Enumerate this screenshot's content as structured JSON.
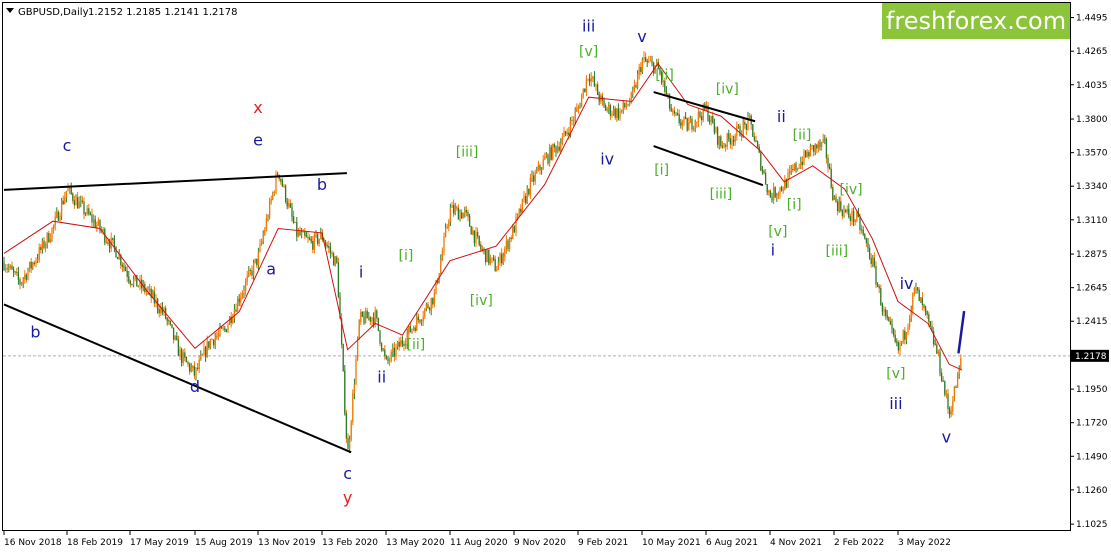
{
  "header": {
    "symbol_label": "GBPUSD,Daily",
    "ohlc": "1.2152 1.2185 1.2141 1.2178",
    "menu_icon": "triangle-down-icon"
  },
  "logo": {
    "text": "freshforex.com",
    "color": "#8cc43a"
  },
  "current_price": {
    "value": "1.2178",
    "badge_color": "#000000"
  },
  "colors": {
    "candle": "#f07800",
    "candle_alt": "#2a7a2a",
    "moving_average": "#d01010",
    "wave_blue": "#1a1aa0",
    "wave_green": "#4ab02a",
    "wave_red": "#e02020"
  },
  "chart_data": {
    "type": "line",
    "instrument": "GBPUSD",
    "timeframe": "Daily",
    "x_tick_labels": [
      "16 Nov 2018",
      "18 Feb 2019",
      "17 May 2019",
      "15 Aug 2019",
      "13 Nov 2019",
      "13 Feb 2020",
      "13 May 2020",
      "11 Aug 2020",
      "9 Nov 2020",
      "9 Feb 2021",
      "10 May 2021",
      "6 Aug 2021",
      "4 Nov 2021",
      "2 Feb 2022",
      "3 May 2022"
    ],
    "y_tick_labels": [
      "1.4495",
      "1.4265",
      "1.4035",
      "1.3800",
      "1.3570",
      "1.3340",
      "1.3110",
      "1.2875",
      "1.2645",
      "1.2415",
      "1.2185",
      "1.1950",
      "1.1720",
      "1.1490",
      "1.1260",
      "1.1025"
    ],
    "ylim": [
      1.0985,
      1.4595
    ],
    "grid": false,
    "series": [
      {
        "name": "GBPUSD",
        "x": [
          "2018-11-16",
          "2018-12-10",
          "2019-01-03",
          "2019-01-28",
          "2019-02-18",
          "2019-03-13",
          "2019-04-05",
          "2019-04-29",
          "2019-05-17",
          "2019-06-10",
          "2019-07-03",
          "2019-07-26",
          "2019-08-15",
          "2019-09-05",
          "2019-09-26",
          "2019-10-17",
          "2019-11-13",
          "2019-12-12",
          "2020-01-07",
          "2020-01-29",
          "2020-02-13",
          "2020-03-05",
          "2020-03-20",
          "2020-04-06",
          "2020-04-28",
          "2020-05-13",
          "2020-06-05",
          "2020-06-26",
          "2020-07-20",
          "2020-08-11",
          "2020-09-01",
          "2020-09-22",
          "2020-10-15",
          "2020-11-09",
          "2020-12-02",
          "2020-12-23",
          "2021-01-18",
          "2021-02-09",
          "2021-02-24",
          "2021-03-17",
          "2021-04-08",
          "2021-04-26",
          "2021-05-10",
          "2021-06-01",
          "2021-06-21",
          "2021-07-12",
          "2021-08-06",
          "2021-08-27",
          "2021-09-17",
          "2021-10-07",
          "2021-10-22",
          "2021-11-04",
          "2021-11-24",
          "2021-12-10",
          "2022-01-03",
          "2022-01-20",
          "2022-02-02",
          "2022-02-17",
          "2022-03-07",
          "2022-03-28",
          "2022-04-13",
          "2022-05-03",
          "2022-05-13",
          "2022-05-27",
          "2022-06-14",
          "2022-06-28",
          "2022-07-14",
          "2022-07-27",
          "2022-08-01"
        ],
        "values": [
          1.282,
          1.268,
          1.285,
          1.305,
          1.332,
          1.318,
          1.305,
          1.289,
          1.271,
          1.262,
          1.247,
          1.218,
          1.205,
          1.228,
          1.235,
          1.258,
          1.285,
          1.345,
          1.302,
          1.295,
          1.3,
          1.28,
          1.149,
          1.243,
          1.245,
          1.212,
          1.228,
          1.242,
          1.259,
          1.318,
          1.315,
          1.292,
          1.278,
          1.305,
          1.335,
          1.352,
          1.366,
          1.387,
          1.412,
          1.388,
          1.384,
          1.394,
          1.42,
          1.415,
          1.382,
          1.375,
          1.387,
          1.362,
          1.37,
          1.378,
          1.35,
          1.327,
          1.335,
          1.347,
          1.36,
          1.362,
          1.325,
          1.316,
          1.311,
          1.282,
          1.247,
          1.221,
          1.234,
          1.264,
          1.241,
          1.218,
          1.178,
          1.205,
          1.218
        ]
      },
      {
        "name": "MA",
        "x": [
          "2018-11-16",
          "2019-01-28",
          "2019-04-05",
          "2019-06-10",
          "2019-08-15",
          "2019-10-17",
          "2019-12-12",
          "2020-02-13",
          "2020-03-20",
          "2020-04-28",
          "2020-06-05",
          "2020-08-11",
          "2020-10-15",
          "2020-12-23",
          "2021-02-24",
          "2021-04-26",
          "2021-06-01",
          "2021-07-12",
          "2021-08-27",
          "2021-10-22",
          "2021-11-24",
          "2022-01-03",
          "2022-02-17",
          "2022-03-28",
          "2022-05-03",
          "2022-06-14",
          "2022-07-14",
          "2022-08-01"
        ],
        "values": [
          1.288,
          1.31,
          1.305,
          1.262,
          1.223,
          1.248,
          1.305,
          1.302,
          1.222,
          1.24,
          1.232,
          1.283,
          1.293,
          1.335,
          1.395,
          1.392,
          1.418,
          1.39,
          1.382,
          1.358,
          1.337,
          1.348,
          1.332,
          1.298,
          1.255,
          1.24,
          1.212,
          1.208
        ]
      }
    ],
    "trend_lines": [
      {
        "x": [
          "2018-11-16",
          "2020-03-19"
        ],
        "y": [
          1.3315,
          1.343
        ]
      },
      {
        "x": [
          "2018-11-16",
          "2020-03-25"
        ],
        "y": [
          1.253,
          1.1517
        ]
      },
      {
        "x": [
          "2021-05-26",
          "2021-10-14"
        ],
        "y": [
          1.3985,
          1.3785
        ]
      },
      {
        "x": [
          "2021-05-26",
          "2021-10-25"
        ],
        "y": [
          1.3615,
          1.3347
        ]
      },
      {
        "x": [
          "2022-07-27",
          "2022-08-04"
        ],
        "y": [
          1.2195,
          1.2485
        ]
      }
    ],
    "annotations": [
      {
        "label": "c",
        "x": "2019-02-18",
        "y": 1.358,
        "color": "#1a1aa0"
      },
      {
        "label": "b",
        "x": "2019-01-02",
        "y": 1.2302,
        "color": "#1a1aa0"
      },
      {
        "label": "x",
        "x": "2019-11-13",
        "y": 1.3842,
        "color": "#e02020"
      },
      {
        "label": "e",
        "x": "2019-11-13",
        "y": 1.362,
        "color": "#1a1aa0"
      },
      {
        "label": "b",
        "x": "2020-02-13",
        "y": 1.3315,
        "color": "#1a1aa0"
      },
      {
        "label": "a",
        "x": "2019-12-02",
        "y": 1.2735,
        "color": "#1a1aa0"
      },
      {
        "label": "d",
        "x": "2019-08-15",
        "y": 1.1929,
        "color": "#1a1aa0"
      },
      {
        "label": "c",
        "x": "2020-03-20",
        "y": 1.1335,
        "color": "#1a1aa0"
      },
      {
        "label": "y",
        "x": "2020-03-20",
        "y": 1.117,
        "color": "#e02020"
      },
      {
        "label": "i",
        "x": "2020-04-08",
        "y": 1.2715,
        "color": "#1a1aa0"
      },
      {
        "label": "ii",
        "x": "2020-05-07",
        "y": 1.1995,
        "color": "#1a1aa0"
      },
      {
        "label": "[i]",
        "x": "2020-06-10",
        "y": 1.2835,
        "color": "#4ab02a"
      },
      {
        "label": "[ii]",
        "x": "2020-06-24",
        "y": 1.2225,
        "color": "#4ab02a"
      },
      {
        "label": "[iii]",
        "x": "2020-09-04",
        "y": 1.3542,
        "color": "#4ab02a"
      },
      {
        "label": "[iv]",
        "x": "2020-09-24",
        "y": 1.2525,
        "color": "#4ab02a"
      },
      {
        "label": "iii",
        "x": "2021-02-24",
        "y": 1.44,
        "color": "#1a1aa0"
      },
      {
        "label": "[v]",
        "x": "2021-02-24",
        "y": 1.4232,
        "color": "#4ab02a"
      },
      {
        "label": "iv",
        "x": "2021-03-22",
        "y": 1.3487,
        "color": "#1a1aa0"
      },
      {
        "label": "v",
        "x": "2021-05-10",
        "y": 1.4328,
        "color": "#1a1aa0"
      },
      {
        "label": "[ii]",
        "x": "2021-06-10",
        "y": 1.4071,
        "color": "#4ab02a"
      },
      {
        "label": "[iv]",
        "x": "2021-09-05",
        "y": 1.3975,
        "color": "#4ab02a"
      },
      {
        "label": "[i]",
        "x": "2021-06-06",
        "y": 1.342,
        "color": "#4ab02a"
      },
      {
        "label": "[iii]",
        "x": "2021-08-27",
        "y": 1.3255,
        "color": "#4ab02a"
      },
      {
        "label": "ii",
        "x": "2021-11-20",
        "y": 1.378,
        "color": "#1a1aa0"
      },
      {
        "label": "[ii]",
        "x": "2021-12-19",
        "y": 1.366,
        "color": "#4ab02a"
      },
      {
        "label": "[iv]",
        "x": "2022-02-26",
        "y": 1.3285,
        "color": "#4ab02a"
      },
      {
        "label": "[i]",
        "x": "2021-12-08",
        "y": 1.3185,
        "color": "#4ab02a"
      },
      {
        "label": "[v]",
        "x": "2021-11-15",
        "y": 1.3,
        "color": "#4ab02a"
      },
      {
        "label": "i",
        "x": "2021-11-08",
        "y": 1.2865,
        "color": "#1a1aa0"
      },
      {
        "label": "[iii]",
        "x": "2022-02-06",
        "y": 1.2865,
        "color": "#4ab02a"
      },
      {
        "label": "iv",
        "x": "2022-05-15",
        "y": 1.2635,
        "color": "#1a1aa0"
      },
      {
        "label": "[v]",
        "x": "2022-04-30",
        "y": 1.2025,
        "color": "#4ab02a"
      },
      {
        "label": "iii",
        "x": "2022-04-30",
        "y": 1.1815,
        "color": "#1a1aa0"
      },
      {
        "label": "v",
        "x": "2022-07-10",
        "y": 1.1585,
        "color": "#1a1aa0"
      }
    ]
  }
}
